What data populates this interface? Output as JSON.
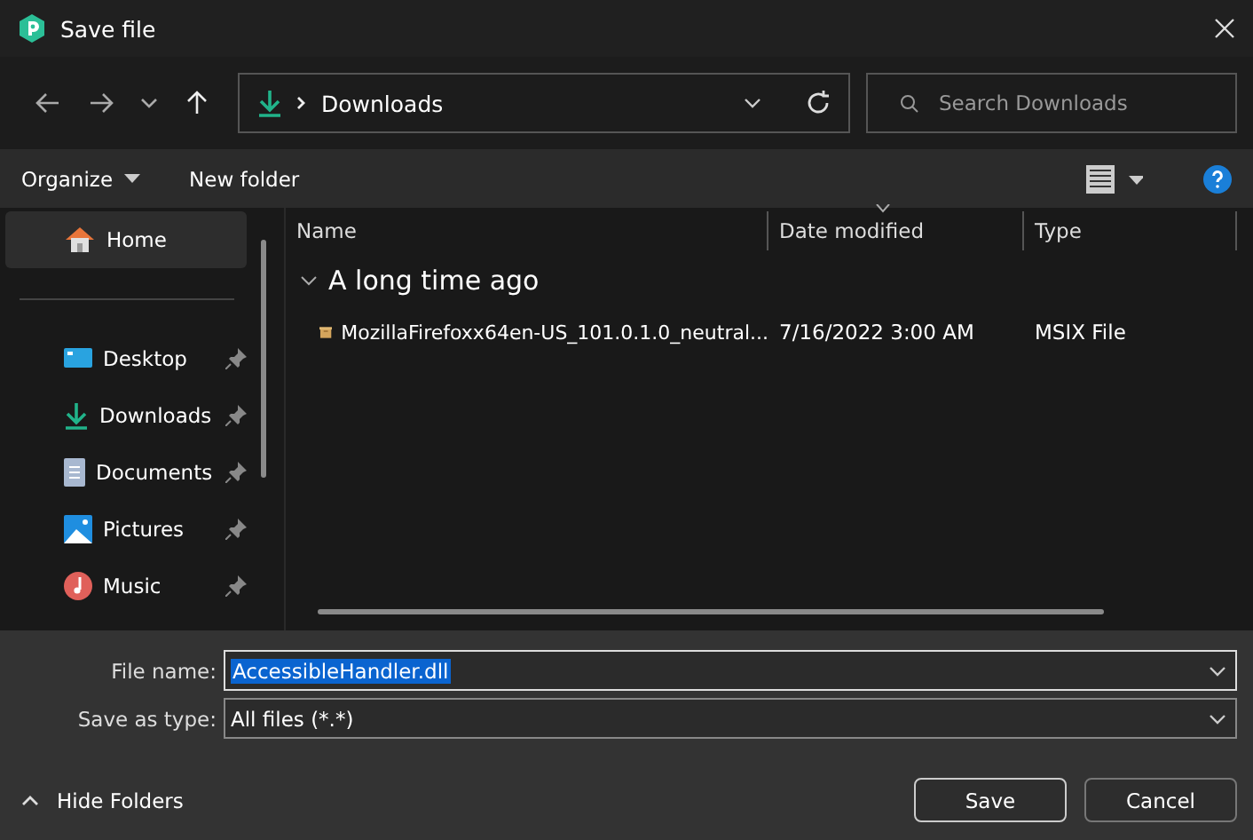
{
  "window": {
    "title": "Save file"
  },
  "address": {
    "path": "Downloads"
  },
  "search": {
    "placeholder": "Search Downloads"
  },
  "toolbar": {
    "organize": "Organize",
    "new_folder": "New folder"
  },
  "sidebar": {
    "items": [
      {
        "label": "Home",
        "kind": "home",
        "selected": true,
        "pinned": false
      },
      {
        "label": "Desktop",
        "kind": "desktop",
        "selected": false,
        "pinned": true
      },
      {
        "label": "Downloads",
        "kind": "downloads",
        "selected": false,
        "pinned": true
      },
      {
        "label": "Documents",
        "kind": "documents",
        "selected": false,
        "pinned": true
      },
      {
        "label": "Pictures",
        "kind": "pictures",
        "selected": false,
        "pinned": true
      },
      {
        "label": "Music",
        "kind": "music",
        "selected": false,
        "pinned": true
      }
    ]
  },
  "table": {
    "columns": [
      "Name",
      "Date modified",
      "Type"
    ],
    "groups": [
      {
        "label": "A long time ago",
        "expanded": true,
        "rows": [
          {
            "name": "MozillaFirefoxx64en-US_101.0.1.0_neutral...",
            "date": "7/16/2022 3:00 AM",
            "type": "MSIX File"
          }
        ]
      }
    ]
  },
  "form": {
    "file_name_label": "File name:",
    "file_name": "AccessibleHandler.dll",
    "type_label": "Save as type:",
    "type": "All files (*.*)"
  },
  "footer": {
    "hide_folders": "Hide Folders",
    "save": "Save",
    "cancel": "Cancel"
  }
}
